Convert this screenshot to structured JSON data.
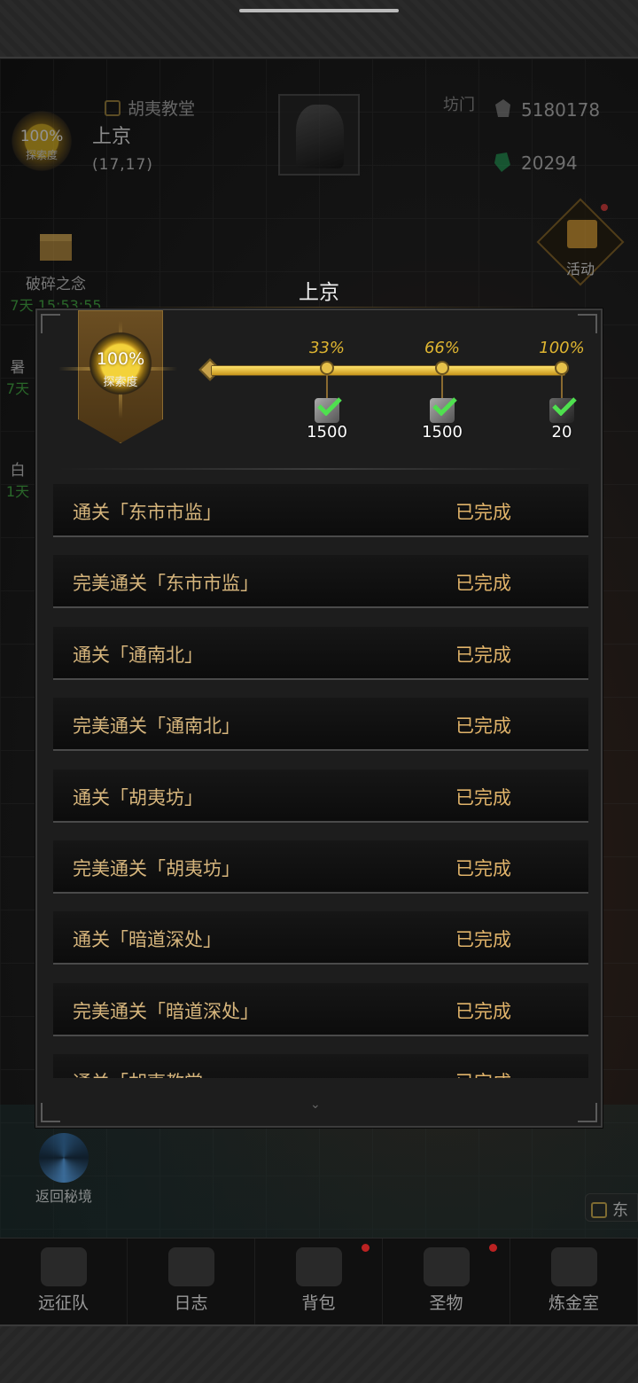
{
  "hud": {
    "exploration_pct": "100%",
    "exploration_label": "探索度",
    "place_name": "上京",
    "coords": "(17,17)",
    "current_quest": "胡夷教堂",
    "partial_left_text": "坊门",
    "currency_1": "5180178",
    "currency_2": "20294"
  },
  "side_buttons": [
    {
      "label": "破碎之念",
      "timer": "7天 15:53:55"
    },
    {
      "label": "暑",
      "timer": "7天"
    },
    {
      "label": "白",
      "timer": "1天"
    }
  ],
  "activity": {
    "label": "活动"
  },
  "return_portal": {
    "label": "返回秘境"
  },
  "east_tag": {
    "label": "东"
  },
  "modal": {
    "title": "上京",
    "exploration_pct": "100%",
    "exploration_label": "探索度",
    "progress": 1.0,
    "milestones": [
      {
        "pct": "33%",
        "amount": "1500"
      },
      {
        "pct": "66%",
        "amount": "1500"
      },
      {
        "pct": "100%",
        "amount": "20"
      }
    ],
    "tasks": [
      {
        "name": "通关「东市市监」",
        "status": "已完成"
      },
      {
        "name": "完美通关「东市市监」",
        "status": "已完成"
      },
      {
        "name": "通关「通南北」",
        "status": "已完成"
      },
      {
        "name": "完美通关「通南北」",
        "status": "已完成"
      },
      {
        "name": "通关「胡夷坊」",
        "status": "已完成"
      },
      {
        "name": "完美通关「胡夷坊」",
        "status": "已完成"
      },
      {
        "name": "通关「暗道深处」",
        "status": "已完成"
      },
      {
        "name": "完美通关「暗道深处」",
        "status": "已完成"
      },
      {
        "name": "通关「胡夷教堂」",
        "status": "已完成"
      }
    ]
  },
  "bottom_nav": [
    {
      "label": "远征队",
      "badge": false
    },
    {
      "label": "日志",
      "badge": false
    },
    {
      "label": "背包",
      "badge": true
    },
    {
      "label": "圣物",
      "badge": true
    },
    {
      "label": "炼金室",
      "badge": false
    }
  ],
  "colors": {
    "gold": "#e0b631",
    "task_text": "#d6b57c",
    "timer_green": "#3fae3f"
  }
}
